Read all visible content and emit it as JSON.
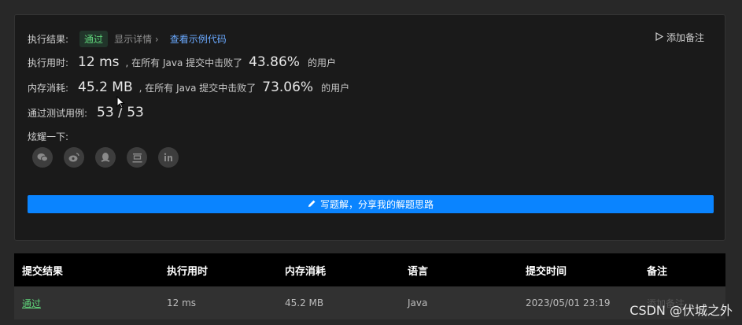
{
  "result": {
    "label": "执行结果:",
    "status": "通过",
    "details_link": "显示详情 ›",
    "example_link": "查看示例代码",
    "add_note": "添加备注"
  },
  "runtime": {
    "label": "执行用时:",
    "value": "12 ms",
    "mid": ", 在所有 Java 提交中击败了",
    "percent": "43.86%",
    "suffix": "的用户"
  },
  "memory": {
    "label": "内存消耗:",
    "value": "45.2 MB",
    "mid": ", 在所有 Java 提交中击败了",
    "percent": "73.06%",
    "suffix": "的用户"
  },
  "tests": {
    "label": "通过测试用例:",
    "value": "53 / 53"
  },
  "share": {
    "label": "炫耀一下:",
    "icons": [
      "wechat-icon",
      "weibo-icon",
      "qq-icon",
      "douban-icon",
      "linkedin-icon"
    ]
  },
  "write_button": "写题解，分享我的解题思路",
  "table": {
    "headers": [
      "提交结果",
      "执行用时",
      "内存消耗",
      "语言",
      "提交时间",
      "备注"
    ],
    "rows": [
      [
        "通过",
        "12 ms",
        "45.2 MB",
        "Java",
        "2023/05/01 23:19",
        "添加备注"
      ]
    ]
  },
  "watermark": "CSDN @伏城之外",
  "colors": {
    "accent": "#0a84ff",
    "success": "#5fd47a",
    "link": "#6aa9ff"
  }
}
